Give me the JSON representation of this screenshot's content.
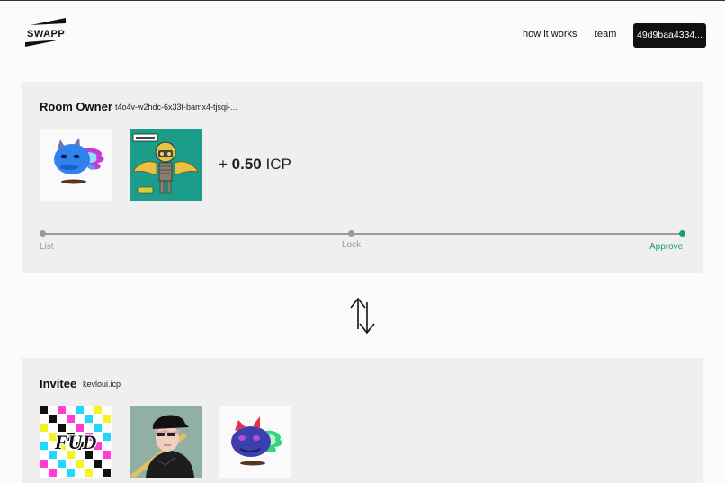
{
  "header": {
    "logo_text": "SWAPP",
    "nav": [
      "how it works",
      "team"
    ],
    "wallet_button": "49d9baa4334..."
  },
  "owner": {
    "title": "Room Owner",
    "principal": "t4o4v-w2hdc-6x33f-bamx4-tjsqi-...",
    "nfts": [
      "blue-creature-nft",
      "winged-robot-nft"
    ],
    "icp_prefix": "+ ",
    "icp_value": "0.50",
    "icp_unit": "ICP",
    "steps": [
      "List",
      "Lock",
      "Approve"
    ],
    "current_step": "Approve",
    "accent_color": "#1f9a7e"
  },
  "invitee": {
    "title": "Invitee",
    "name": "kevloui.icp",
    "nfts": [
      "fud-grid-nft",
      "anime-character-nft",
      "blue-creature-nft"
    ],
    "fud_text": "FUD"
  }
}
